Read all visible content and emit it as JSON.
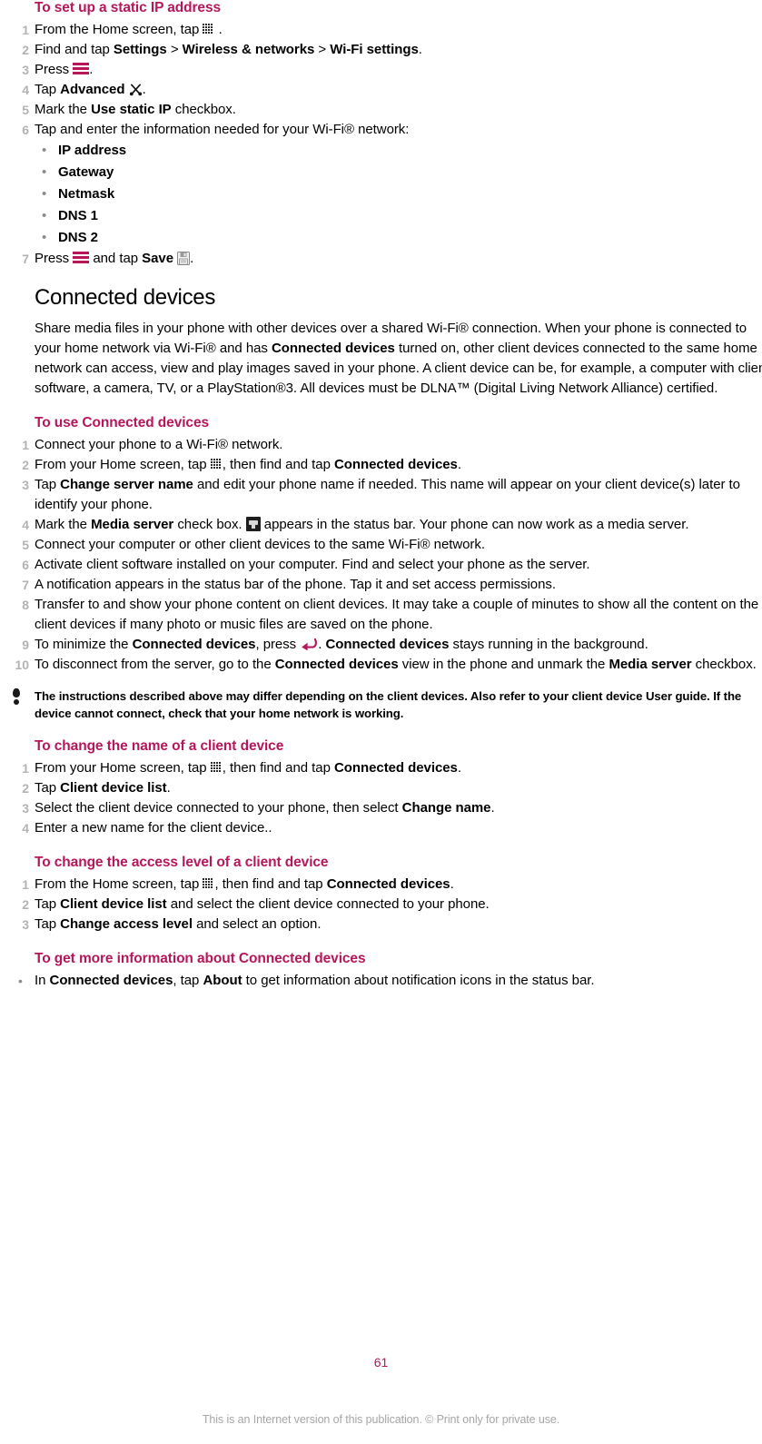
{
  "document": {
    "page_number": "61",
    "footer_note": "This is an Internet version of this publication. © Print only for private use.",
    "accent_color": "#b5175a",
    "number_color": "#b3b3b3"
  },
  "section_static_ip": {
    "heading": "To set up a static IP address",
    "steps": [
      {
        "num": "1",
        "pre": "From the Home screen, tap ",
        "icon": "apps-grid-icon",
        "post": " ."
      },
      {
        "num": "2",
        "pre": "Find and tap ",
        "bold1": "Settings",
        "sep1": " > ",
        "bold2": "Wireless & networks",
        "sep2": " > ",
        "bold3": "Wi-Fi settings",
        "post": "."
      },
      {
        "num": "3",
        "pre": "Press ",
        "icon": "menu-icon",
        "post": "."
      },
      {
        "num": "4",
        "pre": "Tap ",
        "bold1": "Advanced",
        "icon": "tools-icon",
        "post": "."
      },
      {
        "num": "5",
        "pre": "Mark the ",
        "bold1": "Use static IP",
        "post": " checkbox."
      },
      {
        "num": "6",
        "pre": "Tap and enter the information needed for your Wi-Fi® network:"
      },
      {
        "num": "7",
        "pre": "Press ",
        "icon": "menu-icon",
        "mid": " and tap ",
        "bold1": "Save",
        "icon2": "save-icon",
        "post": "."
      }
    ],
    "sub_bullets": [
      "IP address",
      "Gateway",
      "Netmask",
      "DNS 1",
      "DNS 2"
    ]
  },
  "section_connected_devices": {
    "heading": "Connected devices",
    "intro_part1": "Share media files in your phone with other devices over a shared Wi-Fi® connection. When your phone is connected to your home network via Wi-Fi® and has ",
    "intro_bold": "Connected devices",
    "intro_part2": " turned on, other client devices connected to the same home network can access, view and play images saved in your phone. A client device can be, for example, a computer with client software, a camera, TV, or a PlayStation®3. All devices must be DLNA™ (Digital Living Network Alliance) certified."
  },
  "section_use_connected": {
    "heading": "To use Connected devices",
    "steps": [
      {
        "num": "1",
        "text": "Connect your phone to a Wi-Fi® network."
      },
      {
        "num": "2",
        "pre": "From your Home screen, tap ",
        "icon": "apps-grid-icon",
        "mid": ", then find and tap ",
        "bold1": "Connected devices",
        "post": "."
      },
      {
        "num": "3",
        "pre": "Tap ",
        "bold1": "Change server name",
        "post": " and edit your phone name if needed. This name will appear on your client device(s) later to identify your phone."
      },
      {
        "num": "4",
        "pre": "Mark the ",
        "bold1": "Media server",
        "mid": " check box. ",
        "icon": "media-server-icon",
        "post": " appears in the status bar. Your phone can now work as a media server."
      },
      {
        "num": "5",
        "text": "Connect your computer or other client devices to the same Wi-Fi® network."
      },
      {
        "num": "6",
        "text": "Activate client software installed on your computer. Find and select your phone as the server."
      },
      {
        "num": "7",
        "text": "A notification appears in the status bar of the phone. Tap it and set access permissions."
      },
      {
        "num": "8",
        "text": "Transfer to and show your phone content on client devices. It may take a couple of minutes to show all the content on the client devices if many photo or music files are saved on the phone."
      },
      {
        "num": "9",
        "pre": "To minimize the ",
        "bold1": "Connected devices",
        "mid": ", press ",
        "icon": "back-arrow-icon",
        "mid2": ". ",
        "bold2": "Connected devices",
        "post": " stays running in the background."
      },
      {
        "num": "10",
        "pre": "To disconnect from the server, go to the ",
        "bold1": "Connected devices",
        "mid": " view in the phone and unmark the ",
        "bold2": "Media server",
        "post": " checkbox."
      }
    ],
    "note": "The instructions described above may differ depending on the client devices. Also refer to your client device User guide. If the device cannot connect, check that your home network is working."
  },
  "section_change_name": {
    "heading": "To change the name of a client device",
    "steps": [
      {
        "num": "1",
        "pre": "From your Home screen, tap ",
        "icon": "apps-grid-icon",
        "mid": ", then find and tap ",
        "bold1": "Connected devices",
        "post": "."
      },
      {
        "num": "2",
        "pre": "Tap ",
        "bold1": "Client device list",
        "post": "."
      },
      {
        "num": "3",
        "pre": "Select the client device connected to your phone, then select ",
        "bold1": "Change name",
        "post": "."
      },
      {
        "num": "4",
        "text": "Enter a new name for the client device.."
      }
    ]
  },
  "section_access_level": {
    "heading": "To change the access level of a client device",
    "steps": [
      {
        "num": "1",
        "pre": "From the Home screen, tap ",
        "icon": "apps-grid-icon",
        "mid": ", then find and tap ",
        "bold1": "Connected devices",
        "post": "."
      },
      {
        "num": "2",
        "pre": "Tap ",
        "bold1": "Client device list",
        "post": " and select the client device connected to your phone."
      },
      {
        "num": "3",
        "pre": "Tap ",
        "bold1": "Change access level",
        "post": " and select an option."
      }
    ]
  },
  "section_more_info": {
    "heading": "To get more information about Connected devices",
    "bullet": {
      "pre": "In ",
      "bold1": "Connected devices",
      "mid": ", tap ",
      "bold2": "About",
      "post": " to get information about notification icons in the status bar."
    }
  }
}
